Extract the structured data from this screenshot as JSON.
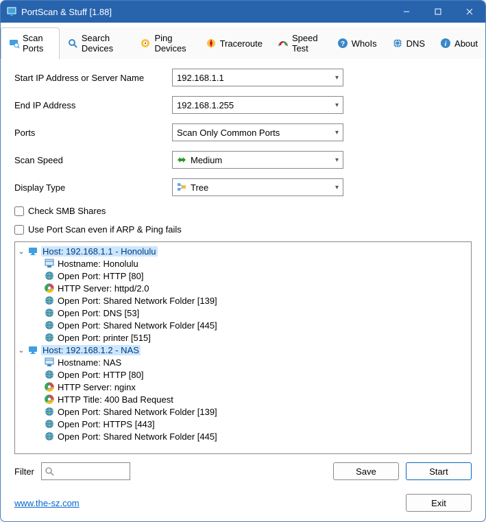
{
  "window": {
    "title": "PortScan & Stuff [1.88]"
  },
  "tabs": [
    {
      "label": "Scan Ports",
      "icon": "scan-ports-icon",
      "active": true
    },
    {
      "label": "Search Devices",
      "icon": "search-devices-icon"
    },
    {
      "label": "Ping Devices",
      "icon": "ping-devices-icon"
    },
    {
      "label": "Traceroute",
      "icon": "traceroute-icon"
    },
    {
      "label": "Speed Test",
      "icon": "speed-test-icon"
    },
    {
      "label": "WhoIs",
      "icon": "whois-icon"
    },
    {
      "label": "DNS",
      "icon": "dns-icon"
    },
    {
      "label": "About",
      "icon": "about-icon"
    }
  ],
  "form": {
    "start_ip_label": "Start IP Address or Server Name",
    "start_ip_value": "192.168.1.1",
    "end_ip_label": "End IP Address",
    "end_ip_value": "192.168.1.255",
    "ports_label": "Ports",
    "ports_value": "Scan Only Common Ports",
    "speed_label": "Scan Speed",
    "speed_value": "Medium",
    "display_label": "Display Type",
    "display_value": "Tree",
    "check_smb_label": "Check SMB Shares",
    "check_arp_label": "Use Port Scan even if ARP & Ping fails"
  },
  "tree": {
    "hosts": [
      {
        "label": "Host: 192.168.1.1 - Honolulu",
        "children": [
          {
            "icon": "hostname-icon",
            "label": "Hostname: Honolulu"
          },
          {
            "icon": "port-icon",
            "label": "Open Port: HTTP [80]"
          },
          {
            "icon": "browser-icon",
            "label": "HTTP Server: httpd/2.0"
          },
          {
            "icon": "port-icon",
            "label": "Open Port: Shared Network Folder [139]"
          },
          {
            "icon": "port-icon",
            "label": "Open Port: DNS [53]"
          },
          {
            "icon": "port-icon",
            "label": "Open Port: Shared Network Folder [445]"
          },
          {
            "icon": "port-icon",
            "label": "Open Port: printer [515]"
          }
        ]
      },
      {
        "label": "Host: 192.168.1.2 - NAS",
        "children": [
          {
            "icon": "hostname-icon",
            "label": "Hostname: NAS"
          },
          {
            "icon": "port-icon",
            "label": "Open Port: HTTP [80]"
          },
          {
            "icon": "browser-icon",
            "label": "HTTP Server: nginx"
          },
          {
            "icon": "browser-icon",
            "label": "HTTP Title: 400 Bad Request"
          },
          {
            "icon": "port-icon",
            "label": "Open Port: Shared Network Folder [139]"
          },
          {
            "icon": "port-icon",
            "label": "Open Port: HTTPS [443]"
          },
          {
            "icon": "port-icon",
            "label": "Open Port: Shared Network Folder [445]"
          }
        ]
      }
    ]
  },
  "bottom": {
    "filter_label": "Filter",
    "save_label": "Save",
    "start_label": "Start"
  },
  "footer": {
    "link_text": "www.the-sz.com",
    "exit_label": "Exit"
  }
}
